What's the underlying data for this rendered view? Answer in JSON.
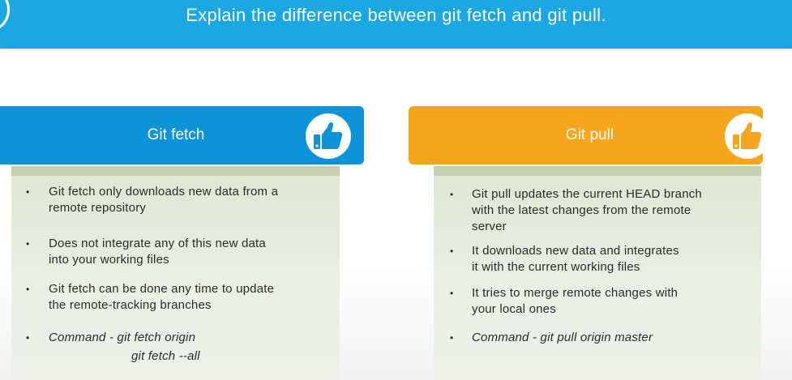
{
  "slide": {
    "title": "Explain the difference between git fetch and git pull."
  },
  "colors": {
    "banner": "#1aa7e3",
    "fetch_header": "#0d93d8",
    "pull_header": "#f7a51d",
    "panel_bg": "#e6ecdd",
    "panel_band": "#c5d0b1"
  },
  "fetch": {
    "title": "Git fetch",
    "icon": "thumbs-up-icon",
    "bullets": [
      "Git fetch only downloads new data from a\nremote repository",
      "Does not integrate any of this new data\ninto your working files",
      "Git fetch can be done any time to update\nthe remote-tracking branches",
      "Command - git fetch origin"
    ],
    "command_extra": "git fetch --all"
  },
  "pull": {
    "title": "Git pull",
    "icon": "thumbs-up-icon",
    "bullets": [
      "Git pull updates the current HEAD branch\nwith the latest changes from the remote\nserver",
      "It downloads new data and integrates\nit with the current working files",
      "It tries to merge remote changes with\nyour local ones",
      "Command - git pull origin master"
    ]
  }
}
